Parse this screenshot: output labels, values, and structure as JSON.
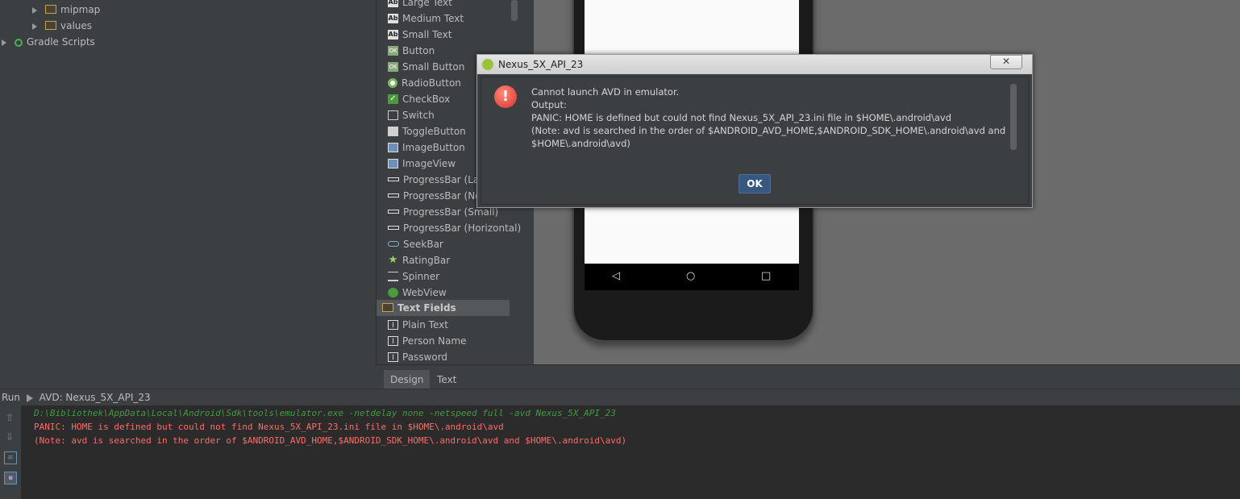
{
  "project_tree": {
    "items": [
      {
        "label": "mipmap",
        "type": "folder"
      },
      {
        "label": "values",
        "type": "folder"
      },
      {
        "label": "Gradle Scripts",
        "type": "gradle"
      }
    ]
  },
  "palette": {
    "widgets": [
      {
        "label": "Large Text",
        "icon": "text-icon"
      },
      {
        "label": "Medium Text",
        "icon": "text-icon"
      },
      {
        "label": "Small Text",
        "icon": "text-icon"
      },
      {
        "label": "Button",
        "icon": "button-icon"
      },
      {
        "label": "Small Button",
        "icon": "button-icon"
      },
      {
        "label": "RadioButton",
        "icon": "radio-icon"
      },
      {
        "label": "CheckBox",
        "icon": "checkbox-icon"
      },
      {
        "label": "Switch",
        "icon": "switch-icon"
      },
      {
        "label": "ToggleButton",
        "icon": "toggle-icon"
      },
      {
        "label": "ImageButton",
        "icon": "image-icon"
      },
      {
        "label": "ImageView",
        "icon": "image-icon"
      },
      {
        "label": "ProgressBar (Large)",
        "icon": "progressbar-icon"
      },
      {
        "label": "ProgressBar (Normal)",
        "icon": "progressbar-icon"
      },
      {
        "label": "ProgressBar (Small)",
        "icon": "progressbar-icon"
      },
      {
        "label": "ProgressBar (Horizontal)",
        "icon": "progressbar-icon"
      },
      {
        "label": "SeekBar",
        "icon": "seekbar-icon"
      },
      {
        "label": "RatingBar",
        "icon": "star-icon"
      },
      {
        "label": "Spinner",
        "icon": "spinner-icon"
      },
      {
        "label": "WebView",
        "icon": "globe-icon"
      }
    ],
    "group": {
      "label": "Text Fields"
    },
    "fields": [
      {
        "label": "Plain Text"
      },
      {
        "label": "Person Name"
      },
      {
        "label": "Password"
      }
    ]
  },
  "editor_tabs": {
    "design": "Design",
    "text": "Text"
  },
  "run_panel": {
    "tab_label": "Run",
    "config": "AVD: Nexus_5X_API_23",
    "lines": [
      {
        "text": "D:\\Bibliothek\\AppData\\Local\\Android\\Sdk\\tools\\emulator.exe -netdelay none -netspeed full -avd Nexus_5X_API_23",
        "color": "#3f9b3f",
        "italic": true
      },
      {
        "text": "PANIC: HOME is defined but could not find Nexus_5X_API_23.ini file in $HOME\\.android\\avd",
        "color": "#ff6b68",
        "italic": false
      },
      {
        "text": "(Note: avd is searched in the order of $ANDROID_AVD_HOME,$ANDROID_SDK_HOME\\.android\\avd and $HOME\\.android\\avd)",
        "color": "#ff6b68",
        "italic": false
      }
    ]
  },
  "dialog": {
    "title": "Nexus_5X_API_23",
    "close_label": "✕",
    "error_icon_glyph": "!",
    "lines": [
      "Cannot launch AVD in emulator.",
      "Output:",
      "PANIC: HOME is defined but could not find Nexus_5X_API_23.ini file in $HOME\\.android\\avd",
      "(Note: avd is searched in the order of $ANDROID_AVD_HOME,$ANDROID_SDK_HOME\\.android\\avd and",
      "$HOME\\.android\\avd)"
    ],
    "ok_label": "OK"
  },
  "phone": {
    "nav": {
      "back": "◁",
      "home": "○",
      "recents": "□"
    }
  }
}
